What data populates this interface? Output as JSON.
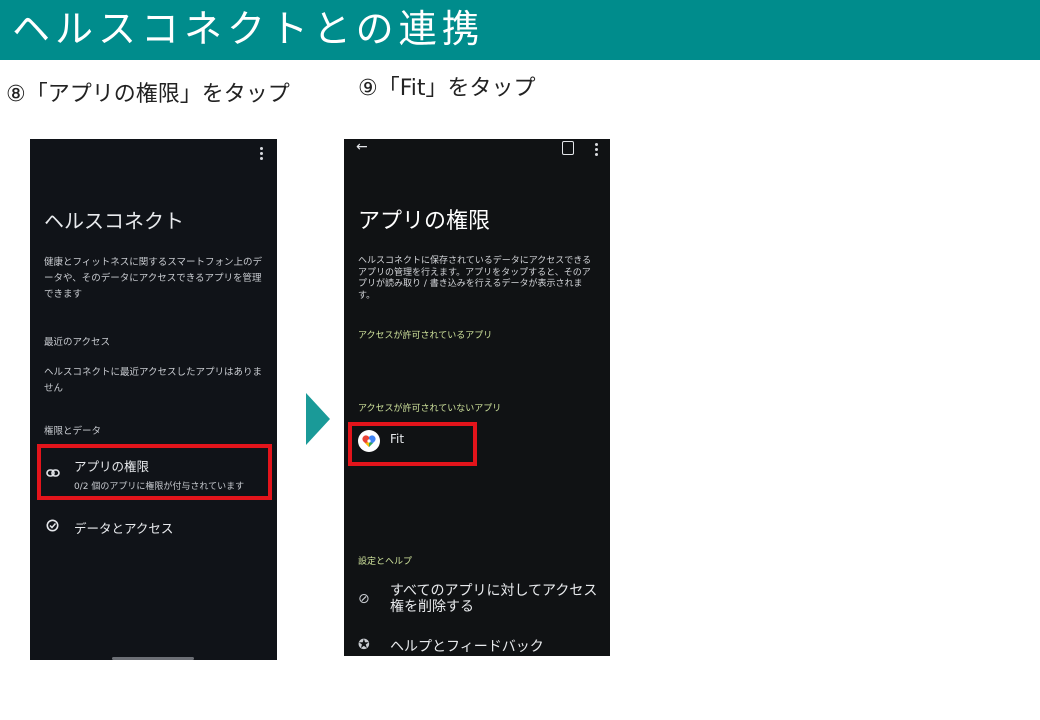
{
  "banner": {
    "title": "ヘルスコネクトとの連携"
  },
  "steps": {
    "left": "⑧「アプリの権限」をタップ",
    "right": "⑨「Fit」をタップ"
  },
  "left_phone": {
    "title": "ヘルスコネクト",
    "description": "健康とフィットネスに関するスマートフォン上のデータや、そのデータにアクセスできるアプリを管理できます",
    "recent_heading": "最近のアクセス",
    "recent_text": "ヘルスコネクトに最近アクセスしたアプリはありません",
    "perm_heading": "権限とデータ",
    "perm_item": {
      "label": "アプリの権限",
      "subtitle": "0/2 個のアプリに権限が付与されています"
    },
    "data_item": {
      "label": "データとアクセス"
    }
  },
  "right_phone": {
    "back_icon": "←",
    "title": "アプリの権限",
    "description": "ヘルスコネクトに保存されているデータにアクセスできるアプリの管理を行えます。アプリをタップすると、そのアプリが読み取り / 書き込みを行えるデータが表示されます。",
    "allowed_heading": "アクセスが許可されているアプリ",
    "not_allowed_heading": "アクセスが許可されていないアプリ",
    "fit_app": {
      "label": "Fit"
    },
    "settings_heading": "設定とヘルプ",
    "remove_access": {
      "icon": "⊘",
      "label": "すべてのアプリに対してアクセス権を削除する"
    },
    "help": {
      "icon": "✪",
      "label": "ヘルプとフィードバック"
    }
  },
  "colors": {
    "banner": "#008c8c",
    "highlight": "#e3141b",
    "section_heading": "#cfe39c"
  }
}
